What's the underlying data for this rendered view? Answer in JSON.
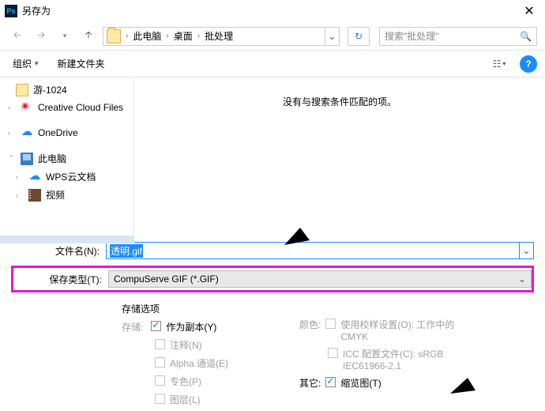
{
  "title": "另存为",
  "breadcrumb": {
    "items": [
      "此电脑",
      "桌面",
      "批处理"
    ]
  },
  "search": {
    "placeholder": "搜索\"批处理\""
  },
  "toolbar": {
    "organize": "组织",
    "newfolder": "新建文件夹"
  },
  "sidebar": {
    "folder1024": "游-1024",
    "cc": "Creative Cloud Files",
    "onedrive": "OneDrive",
    "thispc": "此电脑",
    "wps": "WPS云文档",
    "video": "视频"
  },
  "content": {
    "empty": "没有与搜索条件匹配的项。"
  },
  "form": {
    "filename_label": "文件名(N):",
    "filename_selected": "透明.gif",
    "filetype_label": "保存类型(T):",
    "filetype_value": "CompuServe GIF (*.GIF)"
  },
  "options": {
    "header": "存储选项",
    "store_label": "存储:",
    "as_copy": "作为副本(Y)",
    "annotation": "注释(N)",
    "alpha": "Alpha 通道(E)",
    "spot": "专色(P)",
    "layers": "图层(L)",
    "color_label": "颜色:",
    "proof": "使用校样设置(O): 工作中的 CMYK",
    "icc": "ICC 配置文件(C): sRGB IEC61966-2.1",
    "other_label": "其它:",
    "thumbnail": "缩览图(T)"
  }
}
